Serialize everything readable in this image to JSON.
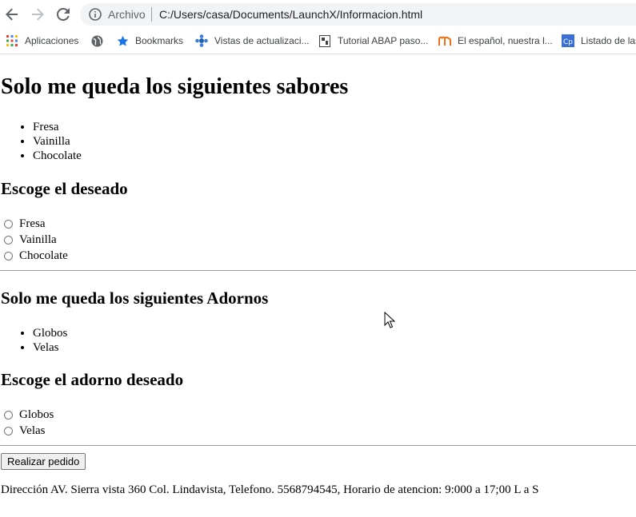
{
  "browser": {
    "scheme_label": "Archivo",
    "url": "C:/Users/casa/Documents/LaunchX/Informacion.html",
    "bookmarks": [
      {
        "label": "Aplicaciones",
        "icon": "apps-grid-icon"
      },
      {
        "label": "",
        "icon": "globe-icon"
      },
      {
        "label": "Bookmarks",
        "icon": "star-icon"
      },
      {
        "label": "Vistas de actualizaci...",
        "icon": "gear-flower-icon"
      },
      {
        "label": "Tutorial ABAP paso...",
        "icon": "page-icon"
      },
      {
        "label": "El español, nuestra l...",
        "icon": "m-logo-icon"
      },
      {
        "label": "Listado de las",
        "icon": "cp-logo-icon"
      }
    ]
  },
  "page": {
    "title": "Solo me queda los siguientes sabores",
    "flavors": [
      "Fresa",
      "Vainilla",
      "Chocolate"
    ],
    "choose_flavor_heading": "Escoge el deseado",
    "flavor_options": [
      "Fresa",
      "Vainilla",
      "Chocolate"
    ],
    "decorations_heading": "Solo me queda los siguientes Adornos",
    "decorations": [
      "Globos",
      "Velas"
    ],
    "choose_decoration_heading": "Escoge el adorno deseado",
    "decoration_options": [
      "Globos",
      "Velas"
    ],
    "submit_label": "Realizar pedido",
    "footer": "Dirección AV. Sierra vista 360 Col. Lindavista, Telefono. 5568794545, Horario de atencion: 9:000 a 17;00 L a S"
  }
}
